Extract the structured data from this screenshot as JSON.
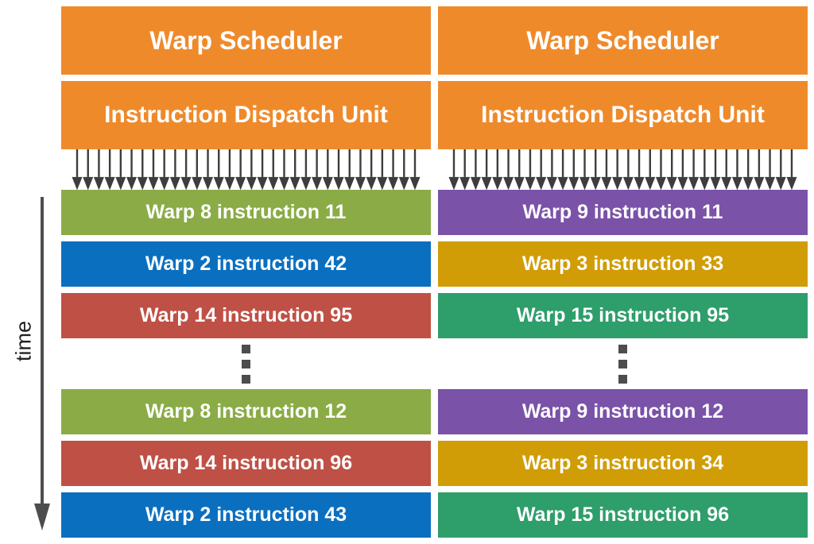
{
  "diagram": {
    "time_axis": {
      "label": "time",
      "icon": "down-arrow-icon",
      "direction": "downward"
    },
    "colors": {
      "unit_orange": "#ef8a2b",
      "green": "#8aab46",
      "blue": "#0b6fbf",
      "red": "#bf5046",
      "purple": "#7a52a8",
      "gold": "#d09d06",
      "teal": "#2e9e6b",
      "arrow_dark": "#3d3d3d",
      "dot_gray": "#4d4d4d",
      "text_white": "#ffffff",
      "text_black": "#231f20",
      "background": "#ffffff"
    },
    "arrow_count_per_column": 32,
    "ellipsis_dots": 3,
    "columns": [
      {
        "scheduler_label": "Warp Scheduler",
        "dispatch_label": "Instruction Dispatch Unit",
        "rows_top": [
          {
            "label": "Warp 8 instruction 11",
            "color": "#8aab46"
          },
          {
            "label": "Warp 2 instruction 42",
            "color": "#0b6fbf"
          },
          {
            "label": "Warp 14 instruction 95",
            "color": "#bf5046"
          }
        ],
        "rows_bottom": [
          {
            "label": "Warp 8 instruction 12",
            "color": "#8aab46"
          },
          {
            "label": "Warp 14 instruction 96",
            "color": "#bf5046"
          },
          {
            "label": "Warp 2 instruction 43",
            "color": "#0b6fbf"
          }
        ]
      },
      {
        "scheduler_label": "Warp Scheduler",
        "dispatch_label": "Instruction Dispatch Unit",
        "rows_top": [
          {
            "label": "Warp 9 instruction 11",
            "color": "#7a52a8"
          },
          {
            "label": "Warp 3 instruction 33",
            "color": "#d09d06"
          },
          {
            "label": "Warp 15 instruction 95",
            "color": "#2e9e6b"
          }
        ],
        "rows_bottom": [
          {
            "label": "Warp 9 instruction 12",
            "color": "#7a52a8"
          },
          {
            "label": "Warp 3 instruction 34",
            "color": "#d09d06"
          },
          {
            "label": "Warp 15 instruction 96",
            "color": "#2e9e6b"
          }
        ]
      }
    ]
  }
}
